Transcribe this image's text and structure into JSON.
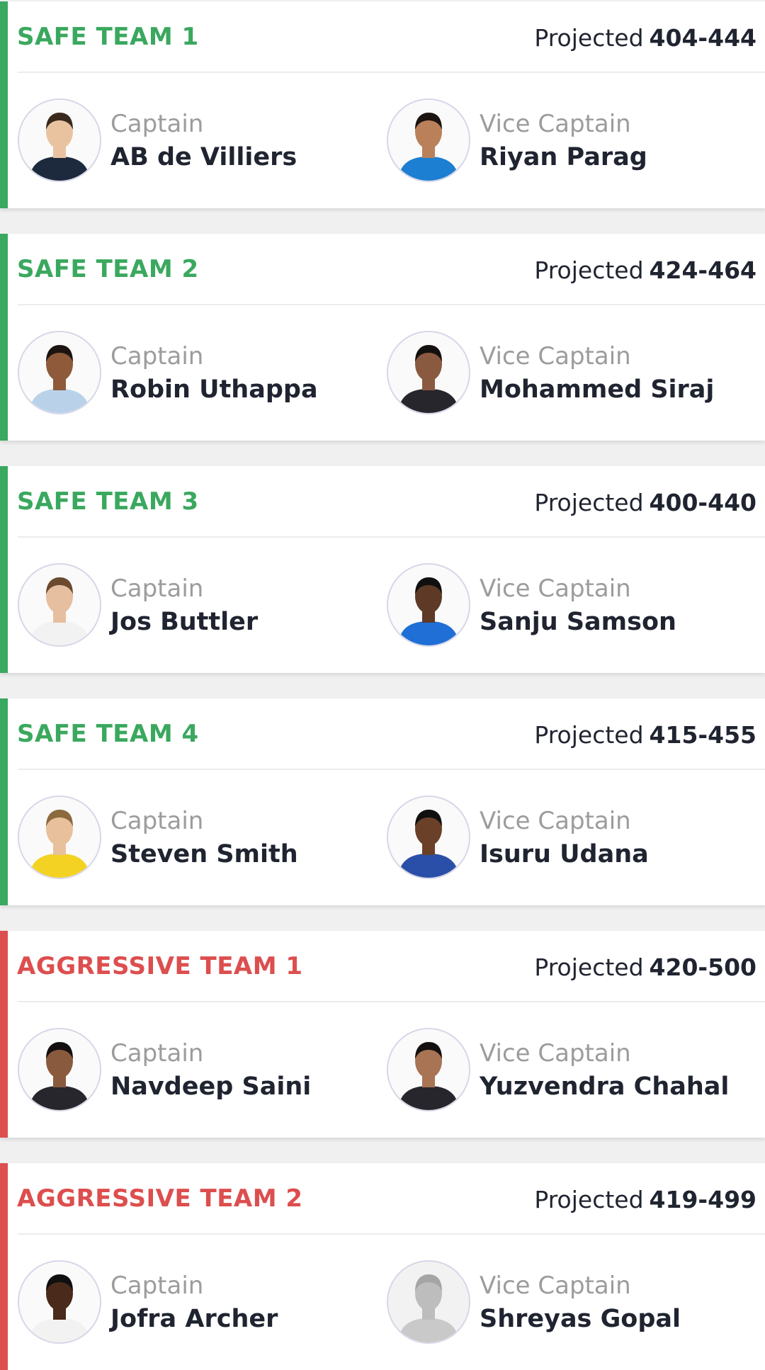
{
  "colors": {
    "safe": "#3aa85e",
    "aggressive": "#dd4e4e",
    "text_dark": "#1f2430",
    "text_muted": "#9c9c9c"
  },
  "labels": {
    "projected": "Projected",
    "captain": "Captain",
    "vice_captain": "Vice Captain"
  },
  "teams": [
    {
      "name": "SAFE TEAM 1",
      "kind": "safe",
      "projected": "404-444",
      "captain": {
        "name": "AB de Villiers",
        "jersey": "#1d2a3d",
        "skin": "#e9c3a0",
        "hair": "#3a2a1e"
      },
      "vice_captain": {
        "name": "Riyan Parag",
        "jersey": "#1c7fd2",
        "skin": "#b9805a",
        "hair": "#1b1410"
      }
    },
    {
      "name": "SAFE TEAM 2",
      "kind": "safe",
      "projected": "424-464",
      "captain": {
        "name": "Robin Uthappa",
        "jersey": "#b9d2ea",
        "skin": "#8e5a3a",
        "hair": "#1b1410"
      },
      "vice_captain": {
        "name": "Mohammed Siraj",
        "jersey": "#26262c",
        "skin": "#8a5a40",
        "hair": "#141010"
      }
    },
    {
      "name": "SAFE TEAM 3",
      "kind": "safe",
      "projected": "400-440",
      "captain": {
        "name": "Jos Buttler",
        "jersey": "#f2f2f2",
        "skin": "#e6bea0",
        "hair": "#6b4a2e"
      },
      "vice_captain": {
        "name": "Sanju Samson",
        "jersey": "#1f6fd6",
        "skin": "#5e3a26",
        "hair": "#101010"
      }
    },
    {
      "name": "SAFE TEAM 4",
      "kind": "safe",
      "projected": "415-455",
      "captain": {
        "name": "Steven Smith",
        "jersey": "#f4d224",
        "skin": "#e8c09c",
        "hair": "#8a6a3e"
      },
      "vice_captain": {
        "name": "Isuru Udana",
        "jersey": "#2a4fa8",
        "skin": "#6a4028",
        "hair": "#101010"
      }
    },
    {
      "name": "AGGRESSIVE TEAM 1",
      "kind": "aggressive",
      "projected": "420-500",
      "captain": {
        "name": "Navdeep Saini",
        "jersey": "#26262c",
        "skin": "#8a5a3e",
        "hair": "#141010"
      },
      "vice_captain": {
        "name": "Yuzvendra Chahal",
        "jersey": "#26262c",
        "skin": "#a87454",
        "hair": "#141010"
      }
    },
    {
      "name": "AGGRESSIVE TEAM 2",
      "kind": "aggressive",
      "projected": "419-499",
      "captain": {
        "name": "Jofra Archer",
        "jersey": "#f2f2f2",
        "skin": "#4a2a1a",
        "hair": "#101010"
      },
      "vice_captain": {
        "name": "Shreyas Gopal",
        "jersey": "#c9c9c9",
        "skin": "#bdbdbd",
        "hair": "#a5a5a5",
        "placeholder": true
      }
    }
  ]
}
